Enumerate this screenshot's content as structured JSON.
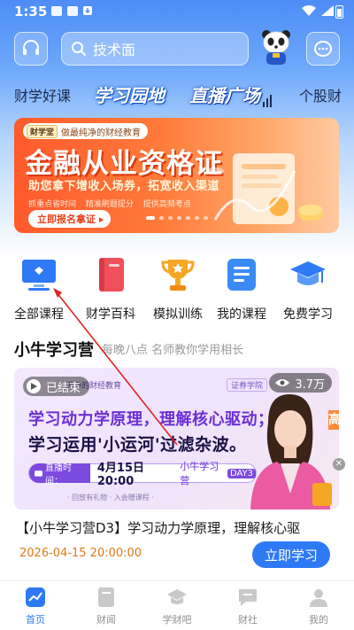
{
  "status_bar": {
    "time": "1:35"
  },
  "search": {
    "placeholder": "技术面"
  },
  "category_tabs": [
    "财学好课",
    "学习园地",
    "直播广场",
    "个股财"
  ],
  "banner": {
    "brand_tag": "财学堂",
    "brand_slogan": "做最纯净的财经教育",
    "headline": "金融从业资格证",
    "subheadline": "助您拿下增收入场券，拓宽收入渠道",
    "points": [
      "抓重点省时间",
      "精准刷题提分",
      "提供高频考点"
    ],
    "cta": "立即报名拿证 ▸",
    "page_count": 7,
    "active_page": 0
  },
  "quick_icons": [
    {
      "label": "全部课程",
      "icon": "monitor-icon",
      "color": "#2e79f5"
    },
    {
      "label": "财学百科",
      "icon": "book-icon",
      "color": "#f0505a"
    },
    {
      "label": "模拟训练",
      "icon": "trophy-icon",
      "color": "#f5a623"
    },
    {
      "label": "我的课程",
      "icon": "document-icon",
      "color": "#3a8bf6"
    },
    {
      "label": "免费学习",
      "icon": "graduation-cap-icon",
      "color": "#2e79f5"
    }
  ],
  "section": {
    "title": "小牛学习营",
    "subtitle": "每晚八点 名师教你学用相长"
  },
  "course": {
    "state": "已结束",
    "views": "3.7万",
    "thumb_brand": "纯净的财经教育",
    "thumb_brand2": "证券学院",
    "thumb_line1": "学习动力学原理，理解核心驱动；",
    "thumb_line2": "学习运用'小运河'过滤杂波。",
    "live_tag": "直播时间：",
    "live_time": "4月15日 20:00",
    "live_brand": "小牛学习营",
    "live_day": "DAY3",
    "thumb_footer": "· 回放有礼物 · 入会赠课程 ·",
    "side_badge": "高亮",
    "title": "【小牛学习营D3】学习动力学原理，理解核心驱",
    "date": "2026-04-15 20:00:00",
    "button": "立即学习"
  },
  "bottom_nav": [
    {
      "label": "首页",
      "icon": "home-chart-icon",
      "active": true
    },
    {
      "label": "财闻",
      "icon": "news-icon",
      "active": false
    },
    {
      "label": "学财吧",
      "icon": "grad-cap-icon",
      "active": false
    },
    {
      "label": "财社",
      "icon": "chat-icon",
      "active": false
    },
    {
      "label": "我的",
      "icon": "user-icon",
      "active": false
    }
  ],
  "colors": {
    "primary": "#2e79f5",
    "header_gradient_top": "#4d8df6",
    "banner_orange": "#ff5a2c",
    "date_orange": "#e07a14",
    "annotation_red": "#e02424"
  }
}
